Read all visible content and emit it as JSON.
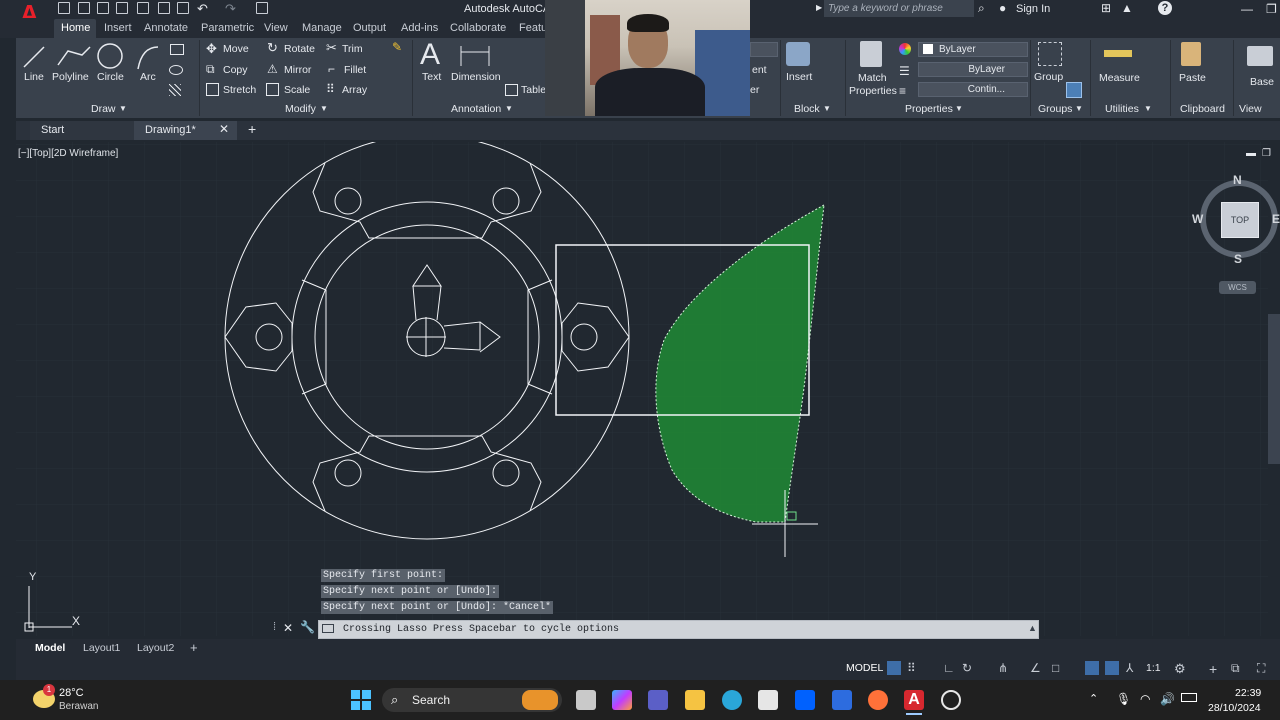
{
  "app": {
    "title": "Autodesk AutoCAD",
    "search_placeholder": "Type a keyword or phrase",
    "sign_in": "Sign In"
  },
  "ribbon_tabs": [
    "Home",
    "Insert",
    "Annotate",
    "Parametric",
    "View",
    "Manage",
    "Output",
    "Add-ins",
    "Collaborate",
    "Featu"
  ],
  "ribbon": {
    "draw": {
      "line": "Line",
      "polyline": "Polyline",
      "circle": "Circle",
      "arc": "Arc",
      "panel": "Draw"
    },
    "modify": {
      "move": "Move",
      "rotate": "Rotate",
      "trim": "Trim",
      "copy": "Copy",
      "mirror": "Mirror",
      "fillet": "Fillet",
      "stretch": "Stretch",
      "scale": "Scale",
      "array": "Array",
      "panel": "Modify"
    },
    "annotation": {
      "text": "Text",
      "dimension": "Dimension",
      "table": "Table",
      "panel": "Annotation"
    },
    "layers_partial": {
      "ent": "ent",
      "er": "er"
    },
    "block": {
      "insert": "Insert",
      "panel": "Block"
    },
    "properties": {
      "match": "Match",
      "match2": "Properties",
      "color": "ByLayer",
      "linetype": "ByLayer",
      "lineweight": "Contin...",
      "panel": "Properties"
    },
    "groups": {
      "group": "Group",
      "panel": "Groups"
    },
    "utilities": {
      "measure": "Measure",
      "panel": "Utilities"
    },
    "clipboard": {
      "paste": "Paste",
      "panel": "Clipboard"
    },
    "view": {
      "base": "Base",
      "panel": "View"
    }
  },
  "file_tabs": {
    "start": "Start",
    "drawing": "Drawing1*"
  },
  "viewport_label": "[−][Top][2D Wireframe]",
  "viewcube": {
    "north": "N",
    "south": "S",
    "west": "W",
    "east": "E",
    "face": "TOP",
    "wcs": "WCS"
  },
  "command": {
    "history": [
      "Specify first point:",
      "Specify next point or [Undo]:",
      "Specify next point or [Undo]: *Cancel*"
    ],
    "prompt": "Crossing Lasso  Press Spacebar to cycle options"
  },
  "ucs": {
    "x": "X",
    "y": "Y"
  },
  "layout_tabs": [
    "Model",
    "Layout1",
    "Layout2"
  ],
  "status": {
    "model": "MODEL",
    "scale": "1:1"
  },
  "taskbar": {
    "temperature": "28°C",
    "weather": "Berawan",
    "weather_badge": "1",
    "search": "Search",
    "time": "22:39",
    "date": "28/10/2024"
  },
  "colors": {
    "lasso_fill": "#1f8a35",
    "canvas_bg": "#212830",
    "accent_red": "#e8202a"
  }
}
